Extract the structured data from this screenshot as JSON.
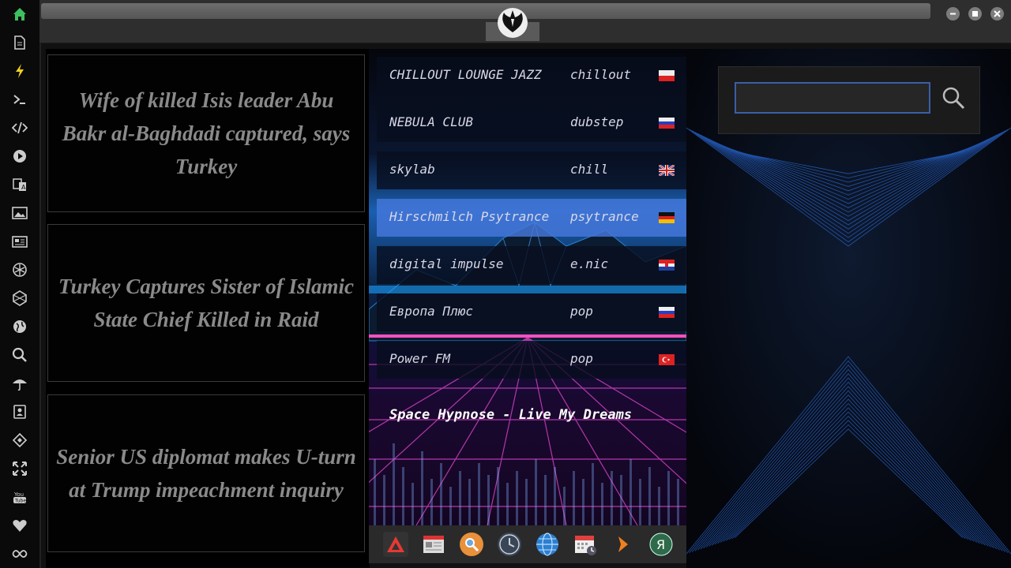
{
  "sidebar": {
    "icons": [
      "home-icon",
      "document-icon",
      "bolt-icon",
      "terminal-icon",
      "code-icon",
      "play-icon",
      "translate-icon",
      "image-icon",
      "newspaper-icon",
      "rebel-icon",
      "hexagon-icon",
      "globe-icon",
      "search-icon",
      "umbrella-icon",
      "contacts-icon",
      "tag-icon",
      "expand-icon",
      "youtube-icon",
      "heart-icon",
      "infinity-icon"
    ]
  },
  "news": [
    {
      "headline": "Wife of killed Isis leader Abu Bakr al-Baghdadi captured, says Turkey"
    },
    {
      "headline": "Turkey Captures Sister of Islamic State Chief Killed in Raid"
    },
    {
      "headline": "Senior US diplomat makes U-turn at Trump impeachment inquiry"
    }
  ],
  "stations": [
    {
      "name": "CHILLOUT LOUNGE JAZZ",
      "genre": "chillout",
      "flag": "pl",
      "active": false
    },
    {
      "name": "NEBULA CLUB",
      "genre": "dubstep",
      "flag": "ru",
      "active": false
    },
    {
      "name": "skylab",
      "genre": "chill",
      "flag": "gb",
      "active": false
    },
    {
      "name": "Hirschmilch Psytrance",
      "genre": "psytrance",
      "flag": "de",
      "active": true
    },
    {
      "name": "digital impulse",
      "genre": "e.nic",
      "flag": "hr",
      "active": false
    },
    {
      "name": "Европа Плюс",
      "genre": "pop",
      "flag": "ru",
      "active": false
    },
    {
      "name": "Power FM",
      "genre": "pop",
      "flag": "tr",
      "active": false
    }
  ],
  "now_playing": "Space Hypnose - Live My Dreams",
  "dock": {
    "icons": [
      "anydesk-icon",
      "news-reader-icon",
      "search-tool-icon",
      "clock-icon",
      "browser-icon",
      "calendar-icon",
      "arrow-icon",
      "yandex-icon"
    ]
  },
  "search": {
    "value": "",
    "placeholder": ""
  },
  "colors": {
    "accent": "#3a5ea8",
    "active_station": "#4678dc",
    "sidebar_home": "#3fbf5f"
  }
}
